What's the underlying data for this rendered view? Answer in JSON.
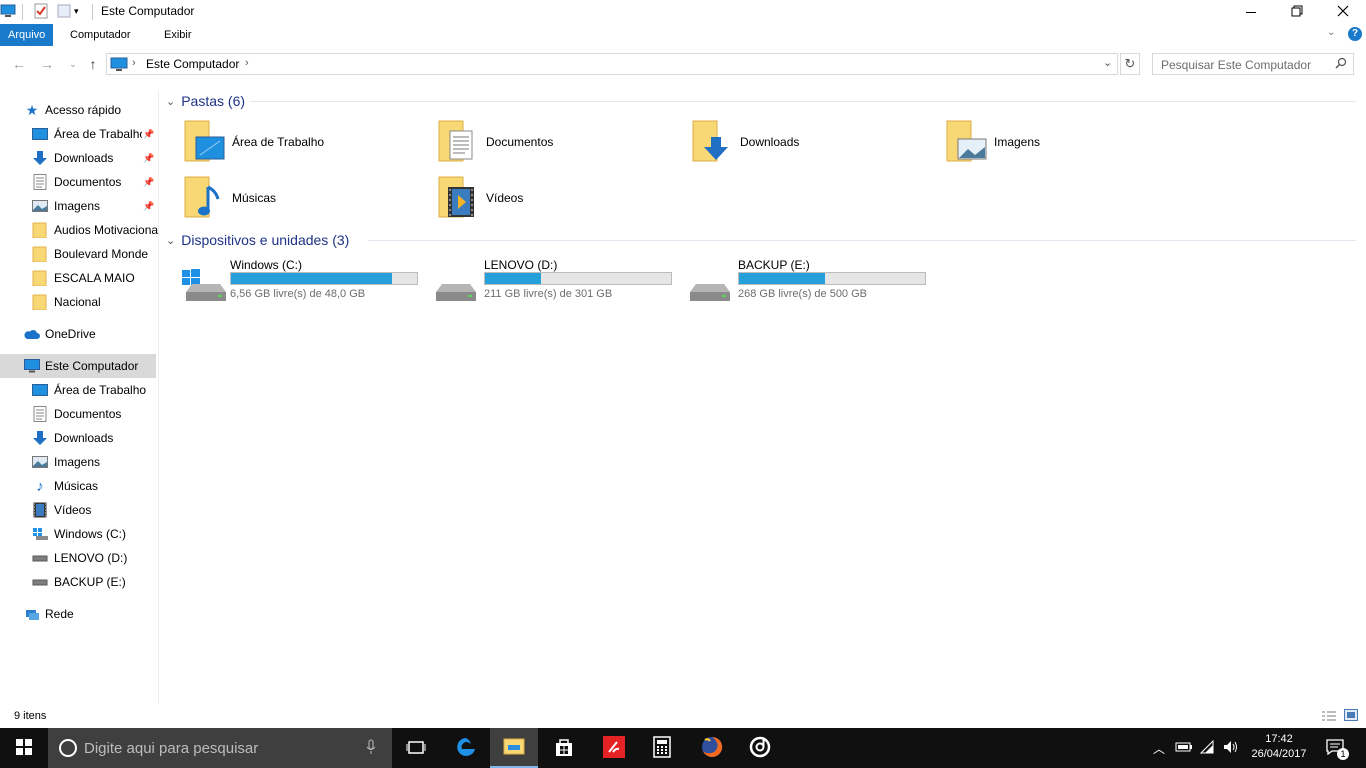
{
  "window": {
    "title": "Este Computador",
    "controls": {
      "minimize": "—",
      "maximize": "❐",
      "close": "✕"
    }
  },
  "ribbon": {
    "tabs": [
      {
        "label": "Arquivo",
        "active": true
      },
      {
        "label": "Computador",
        "active": false
      },
      {
        "label": "Exibir",
        "active": false
      }
    ],
    "help": "?"
  },
  "address": {
    "path": "Este Computador",
    "search_placeholder": "Pesquisar Este Computador"
  },
  "sidebar": {
    "quick_access": {
      "label": "Acesso rápido"
    },
    "quick_items": [
      {
        "label": "Área de Trabalho",
        "icon": "desktop-icon",
        "pinned": true
      },
      {
        "label": "Downloads",
        "icon": "download-icon",
        "pinned": true
      },
      {
        "label": "Documentos",
        "icon": "document-icon",
        "pinned": true
      },
      {
        "label": "Imagens",
        "icon": "pictures-icon",
        "pinned": true
      },
      {
        "label": "Audios Motivacionais",
        "icon": "folder-icon",
        "pinned": false
      },
      {
        "label": "Boulevard Monde",
        "icon": "folder-icon",
        "pinned": false
      },
      {
        "label": "ESCALA MAIO",
        "icon": "folder-icon",
        "pinned": false
      },
      {
        "label": "Nacional",
        "icon": "folder-icon",
        "pinned": false
      }
    ],
    "onedrive": {
      "label": "OneDrive"
    },
    "this_pc": {
      "label": "Este Computador"
    },
    "pc_items": [
      {
        "label": "Área de Trabalho",
        "icon": "desktop-icon"
      },
      {
        "label": "Documentos",
        "icon": "document-icon"
      },
      {
        "label": "Downloads",
        "icon": "download-icon"
      },
      {
        "label": "Imagens",
        "icon": "pictures-icon"
      },
      {
        "label": "Músicas",
        "icon": "music-icon"
      },
      {
        "label": "Vídeos",
        "icon": "video-icon"
      },
      {
        "label": "Windows (C:)",
        "icon": "windows-drive-icon"
      },
      {
        "label": "LENOVO (D:)",
        "icon": "drive-icon"
      },
      {
        "label": "BACKUP (E:)",
        "icon": "drive-icon"
      }
    ],
    "network": {
      "label": "Rede"
    }
  },
  "content": {
    "folders_header": "Pastas (6)",
    "folders": [
      {
        "label": "Área de Trabalho",
        "overlay": "desktop"
      },
      {
        "label": "Documentos",
        "overlay": "document"
      },
      {
        "label": "Downloads",
        "overlay": "download"
      },
      {
        "label": "Imagens",
        "overlay": "pictures"
      },
      {
        "label": "Músicas",
        "overlay": "music"
      },
      {
        "label": "Vídeos",
        "overlay": "video"
      }
    ],
    "devices_header": "Dispositivos e unidades (3)",
    "drives": [
      {
        "name": "Windows (C:)",
        "free_text": "6,56 GB livre(s) de 48,0 GB",
        "used_fraction": 0.863,
        "windows": true
      },
      {
        "name": "LENOVO (D:)",
        "free_text": "211 GB livre(s) de 301 GB",
        "used_fraction": 0.3,
        "windows": false
      },
      {
        "name": "BACKUP (E:)",
        "free_text": "268 GB livre(s) de 500 GB",
        "used_fraction": 0.464,
        "windows": false
      }
    ]
  },
  "status": {
    "item_count": "9 itens"
  },
  "taskbar": {
    "search_placeholder": "Digite aqui para pesquisar",
    "apps": [
      {
        "name": "task-view-icon"
      },
      {
        "name": "edge-icon"
      },
      {
        "name": "file-explorer-icon",
        "active": true
      },
      {
        "name": "store-icon"
      },
      {
        "name": "app-red-icon"
      },
      {
        "name": "calculator-icon"
      },
      {
        "name": "firefox-icon"
      },
      {
        "name": "groove-icon"
      }
    ],
    "time": "17:42",
    "date": "26/04/2017",
    "notification_count": "1"
  },
  "colors": {
    "accent": "#1979ca",
    "header_text": "#1e3287",
    "drive_fill": "#26a0da",
    "taskbar": "#101010"
  }
}
